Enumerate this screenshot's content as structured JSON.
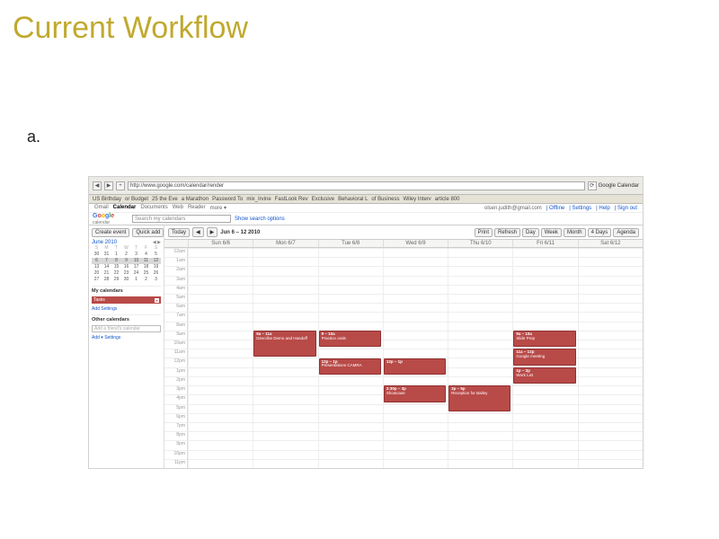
{
  "slide": {
    "title": "Current Workflow",
    "list_marker": "a."
  },
  "browser": {
    "url": "http://www.google.com/calendar/render",
    "search_label": "Google Calendar",
    "bookmarks": [
      "US Birthday",
      "or Budget",
      "25 the Eve",
      "a Marathon",
      "Password To",
      "mix_Irvine",
      "FastLook Rev",
      "Exclusive",
      "Behavioral L",
      "of Business",
      "Wiley Interv",
      "article 800"
    ]
  },
  "gbar": {
    "links": [
      "Gmail",
      "Calendar",
      "Documents",
      "Web",
      "Reader",
      "more ▾"
    ],
    "active": "Calendar",
    "account": "olsen.judith@gmail.com",
    "account_links": [
      "Offline",
      "Settings",
      "Help",
      "Sign out"
    ]
  },
  "logo_sub": "calendar",
  "search": {
    "placeholder": "Search my calendars",
    "options": "Show search options"
  },
  "sidebar": {
    "create": "Create event",
    "quick": "Quick add",
    "month_label": "June 2010",
    "dow": [
      "S",
      "M",
      "T",
      "W",
      "T",
      "F",
      "S"
    ],
    "days": [
      [
        "30",
        "31",
        "1",
        "2",
        "3",
        "4",
        "5"
      ],
      [
        "6",
        "7",
        "8",
        "9",
        "10",
        "11",
        "12"
      ],
      [
        "13",
        "14",
        "15",
        "16",
        "17",
        "18",
        "19"
      ],
      [
        "20",
        "21",
        "22",
        "23",
        "24",
        "25",
        "26"
      ],
      [
        "27",
        "28",
        "29",
        "30",
        "1",
        "2",
        "3"
      ]
    ],
    "my_cal_h": "My calendars",
    "my_cal_name": "Tasks",
    "my_cal_links": [
      "Add",
      "Settings"
    ],
    "other_h": "Other calendars",
    "other_placeholder": "Add a friend's calendar",
    "other_links": [
      "Add ▾",
      "Settings"
    ]
  },
  "toolbar": {
    "today": "Today",
    "date": "Jun 6 – 12 2010",
    "print": "Print",
    "refresh": "Refresh",
    "views": [
      "Day",
      "Week",
      "Month",
      "4 Days",
      "Agenda"
    ]
  },
  "day_headers": [
    "Sun 6/6",
    "Mon 6/7",
    "Tue 6/8",
    "Wed 6/9",
    "Thu 6/10",
    "Fri 6/11",
    "Sat 6/12"
  ],
  "hours": [
    "12am",
    "1am",
    "2am",
    "3am",
    "4am",
    "5am",
    "6am",
    "7am",
    "8am",
    "9am",
    "10am",
    "11am",
    "12pm",
    "1pm",
    "2pm",
    "3pm",
    "4pm",
    "5pm",
    "6pm",
    "7pm",
    "8pm",
    "9pm",
    "10pm",
    "11pm"
  ],
  "events": [
    {
      "day": 1,
      "startRow": 9,
      "span": 3,
      "time": "9a – 11a",
      "title": "Describe Demo and Handoff"
    },
    {
      "day": 2,
      "startRow": 9,
      "span": 2,
      "time": "9 – 10a",
      "title": "Practice orals"
    },
    {
      "day": 2,
      "startRow": 12,
      "span": 2,
      "time": "12p – 1p",
      "title": "Presentations CAMRA"
    },
    {
      "day": 3,
      "startRow": 12,
      "span": 2,
      "time": "12p – 1p",
      "title": ""
    },
    {
      "day": 3,
      "startRow": 15,
      "span": 2,
      "time": "2:30p – 3p",
      "title": "Showcase"
    },
    {
      "day": 4,
      "startRow": 15,
      "span": 3,
      "time": "3p – 5p",
      "title": "Reception for Bailey"
    },
    {
      "day": 5,
      "startRow": 9,
      "span": 2,
      "time": "9a – 10a",
      "title": "Slide Prep"
    },
    {
      "day": 5,
      "startRow": 11,
      "span": 2,
      "time": "11a – 12p",
      "title": "Google meeting"
    },
    {
      "day": 5,
      "startRow": 13,
      "span": 2,
      "time": "1p – 2p",
      "title": "Work List"
    }
  ]
}
